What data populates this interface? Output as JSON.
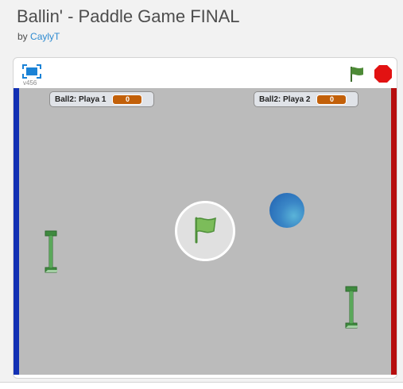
{
  "project": {
    "title": "Ballin' - Paddle Game FINAL",
    "by_prefix": "by",
    "author": "CaylyT"
  },
  "player": {
    "version": "v456",
    "icons": {
      "fullscreen": "fullscreen-icon",
      "green_flag": "green-flag-icon",
      "stop": "stop-sign-icon"
    }
  },
  "stage": {
    "monitors": [
      {
        "label": "Ball2: Playa 1",
        "value": "0"
      },
      {
        "label": "Ball2: Playa 2",
        "value": "0"
      }
    ],
    "colors": {
      "background": "#bbbbbb",
      "left_wall": "#1230b4",
      "right_wall": "#b60d0d",
      "paddle": "#3f8a3f",
      "ball": "#2a72bd",
      "monitor_value": "#c2600a"
    },
    "sprites": [
      "ball",
      "paddle-left",
      "paddle-right"
    ]
  }
}
